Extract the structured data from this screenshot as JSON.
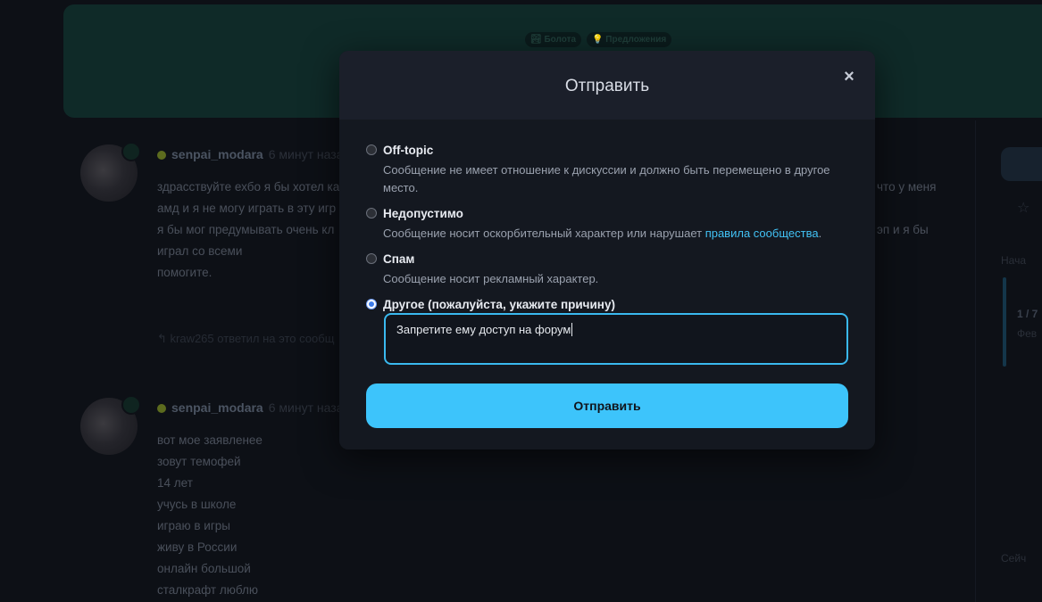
{
  "background": {
    "tags": [
      "🏞 Болота",
      "💡 Предложения"
    ],
    "posts": [
      {
        "username": "senpai_modara",
        "time": "6 минут назад",
        "lines": [
          "здрасствуйте ехбо я бы хотел ка",
          "амд и я не могу играть в эту игр",
          "я бы мог предумывать очень кл",
          "играл со всеми",
          "помогите."
        ],
        "right_fragments": [
          "что у меня",
          "эп и я бы"
        ],
        "reply_note": "↰ kraw265 ответил на это сообщ"
      },
      {
        "username": "senpai_modara",
        "time": "6 минут назад",
        "lines": [
          "вот мое заявленее",
          "зовут темофей",
          "14 лет",
          "учусь в школе",
          "играю в игры",
          "живу в России",
          "онлайн большой",
          "сталкрафт люблю"
        ]
      }
    ],
    "sidebar": {
      "start_label": "Нача",
      "progress": "1 / 7",
      "date_label": "Фев",
      "today_label": "Сейч"
    }
  },
  "modal": {
    "title": "Отправить",
    "close_glyph": "×",
    "options": [
      {
        "title": "Off-topic",
        "description": "Сообщение не имеет отношение к дискуссии и должно быть перемещено в другое место.",
        "checked": false
      },
      {
        "title": "Недопустимо",
        "description": "Сообщение носит оскорбительный характер или нарушает ",
        "link": "правила сообщества",
        "description_end": ".",
        "checked": false
      },
      {
        "title": "Спам",
        "description": "Сообщение носит рекламный характер.",
        "checked": false
      },
      {
        "title": "Другое (пожалуйста, укажите причину)",
        "checked": true
      }
    ],
    "reason_value": "Запретите ему доступ на форум",
    "submit_label": "Отправить"
  }
}
